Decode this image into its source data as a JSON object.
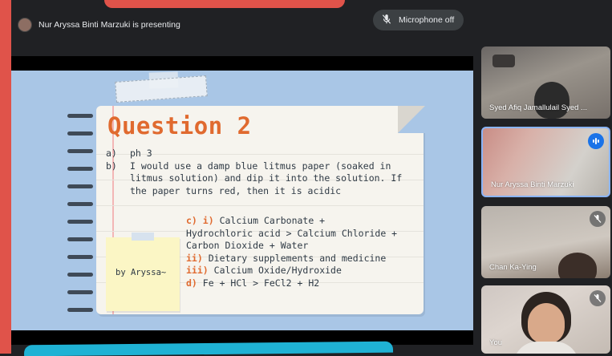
{
  "meeting": {
    "presenting_label": "Nur Aryssa Binti Marzuki is presenting",
    "mic_status": "Microphone off"
  },
  "slide": {
    "title": "Question 2",
    "answers": [
      {
        "label": "a)",
        "text": "ph 3"
      },
      {
        "label": "b)",
        "text": "I would use a damp blue litmus paper (soaked in litmus solution) and dip it into the solution. If the paper turns red, then it is acidic"
      }
    ],
    "c_block": {
      "line1_prefix": "c) i)",
      "line1_text": "Calcium Carbonate +",
      "line2": "Hydrochloric acid > Calcium Chloride +",
      "line3": "Carbon Dioxide + Water",
      "line4_prefix": "ii)",
      "line4_text": "Dietary supplements and medicine",
      "line5_prefix": "iii)",
      "line5_text": "Calcium Oxide/Hydroxide",
      "line6_prefix": "d)",
      "line6_text": "Fe + HCl > FeCl2 + H2"
    },
    "sticky_note": "by Aryssa~",
    "colors": {
      "title": "#e06a2f",
      "background": "#a9c6e6",
      "paper": "#f6f4ee"
    }
  },
  "participants": [
    {
      "name": "Syed Afiq Jamallulail Syed ...",
      "state": "video"
    },
    {
      "name": "Nur Aryssa Binti Marzuki",
      "state": "speaking"
    },
    {
      "name": "Chan Ka-Ying",
      "state": "muted"
    },
    {
      "name": "You",
      "state": "muted"
    }
  ],
  "icons": {
    "mic_off": "mic-off-icon",
    "speaking": "audio-level-icon",
    "presenter": "presenter-avatar"
  }
}
